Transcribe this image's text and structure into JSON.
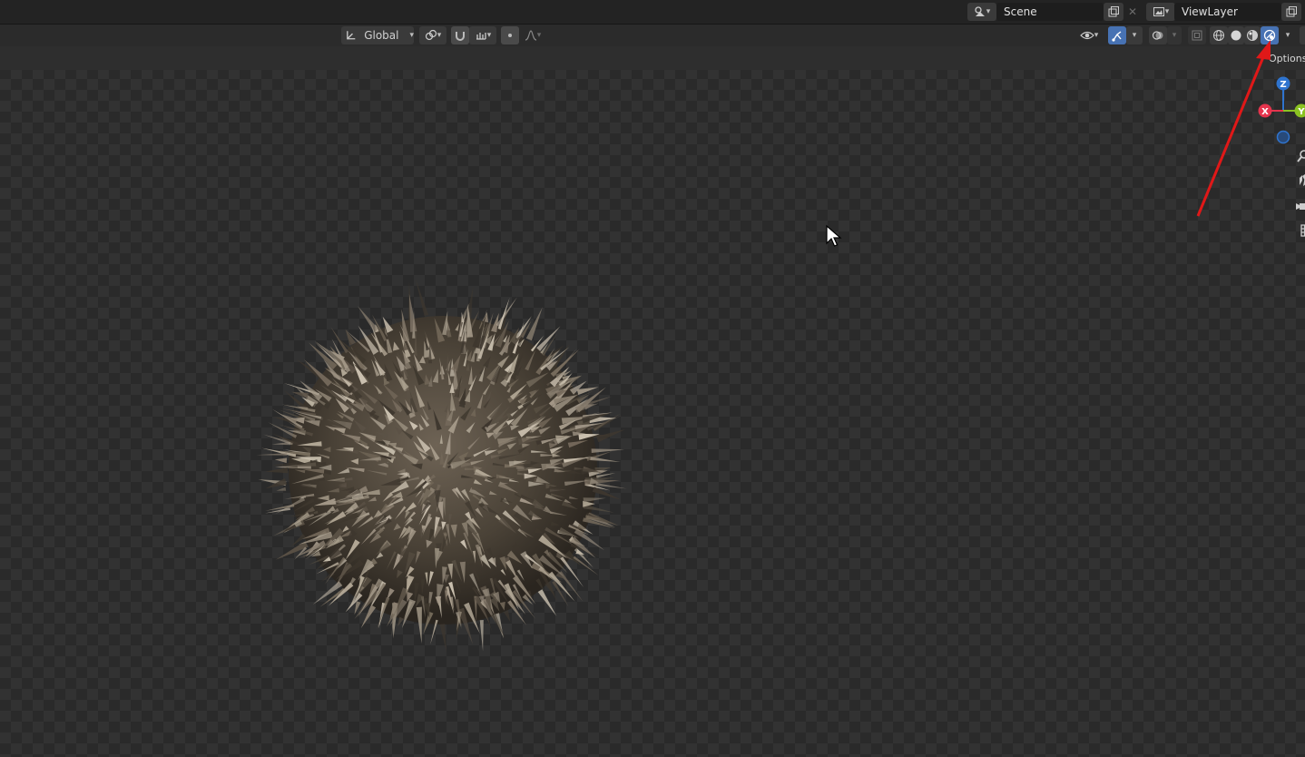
{
  "header": {
    "scene_label": "Scene",
    "viewlayer_label": "ViewLayer"
  },
  "viewport_header": {
    "transform_orientation": "Global",
    "shading_modes": [
      "wireframe-icon",
      "solid-icon",
      "material-preview-icon",
      "rendered-icon"
    ],
    "active_shading": "rendered",
    "options_label": "Options"
  },
  "gizmo": {
    "z_label": "Z",
    "x_label": "X",
    "y_label": "Y",
    "colors": {
      "x": "#e5344d",
      "y": "#8bc222",
      "z": "#2f74cf"
    }
  },
  "annotation": {
    "color": "#e01818",
    "target": "rendered-shading-button"
  },
  "accent_color": "#4772b3"
}
